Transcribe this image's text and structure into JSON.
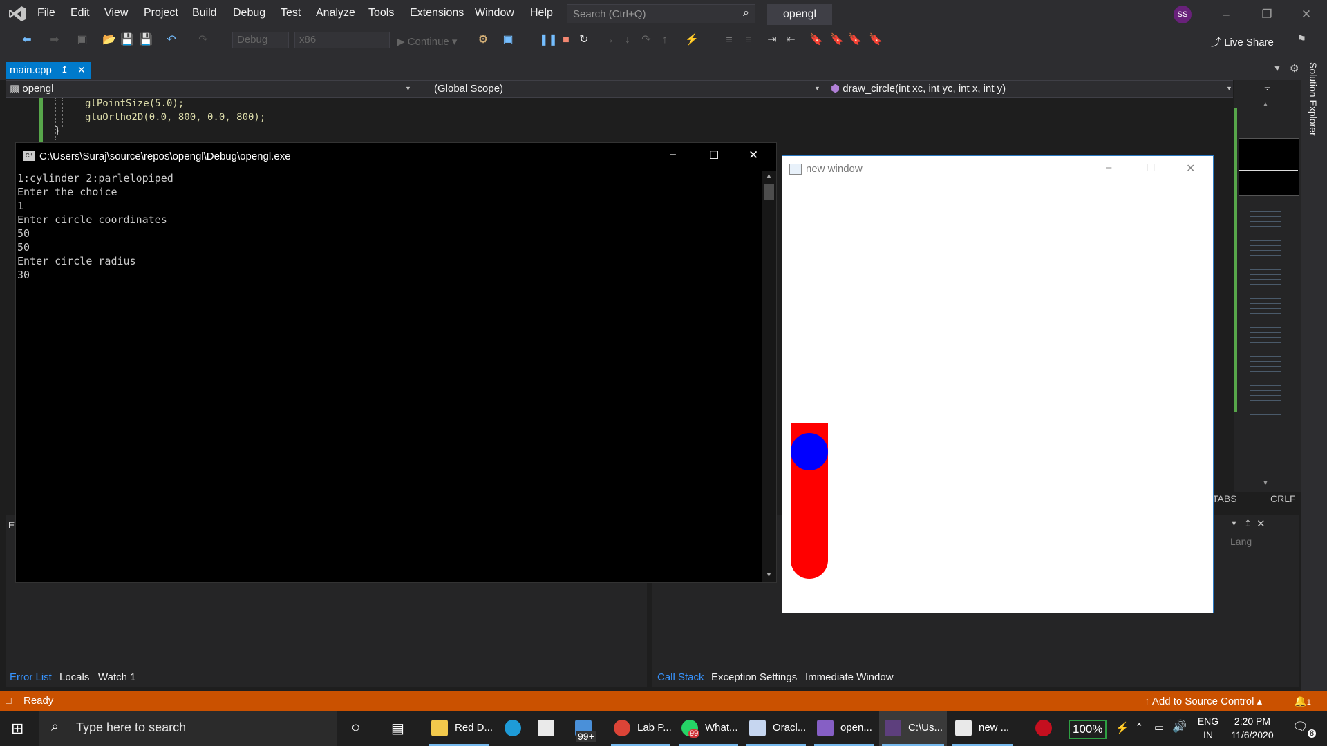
{
  "menubar": {
    "items": [
      "File",
      "Edit",
      "View",
      "Project",
      "Build",
      "Debug",
      "Test",
      "Analyze",
      "Tools",
      "Extensions",
      "Window",
      "Help"
    ],
    "search_placeholder": "Search (Ctrl+Q)",
    "project_name": "opengl",
    "avatar_initials": "SS"
  },
  "toolbar": {
    "config": "Debug",
    "platform": "x86",
    "continue_label": "Continue",
    "live_share": "Live Share"
  },
  "tabs": {
    "doc_tab": "main.cpp",
    "project_combo": "opengl",
    "scope_combo": "(Global Scope)",
    "function_combo": "draw_circle(int xc, int yc, int x, int y)"
  },
  "editor": {
    "code_lines": [
      "glPointSize(5.0);",
      "gluOrtho2D(0.0, 800, 0.0, 800);",
      "}"
    ]
  },
  "side": {
    "solution_explorer": "Solution Explorer"
  },
  "console": {
    "title": "C:\\Users\\Suraj\\source\\repos\\opengl\\Debug\\opengl.exe",
    "lines": [
      "1:cylinder 2:parlelopiped",
      "Enter the choice",
      "1",
      "Enter circle coordinates",
      "50",
      "50",
      "Enter circle radius",
      "30"
    ]
  },
  "glwindow": {
    "title": "new window",
    "colors": {
      "body": "#ff0000",
      "top": "#0000ff"
    }
  },
  "editor_status": {
    "tabs": "TABS",
    "crlf": "CRLF",
    "lang": "Lang"
  },
  "bottom": {
    "left_tabs": [
      "Error List",
      "Locals",
      "Watch 1"
    ],
    "right_tabs": [
      "Call Stack",
      "Exception Settings",
      "Immediate Window"
    ]
  },
  "status": {
    "ready": "Ready",
    "source_control": "Add to Source Control",
    "notifications": "1"
  },
  "taskbar": {
    "search_placeholder": "Type here to search",
    "apps": [
      {
        "label": "Red D...",
        "color": "#f2c94c"
      },
      {
        "label": "Lab P...",
        "color": "#db4437"
      },
      {
        "label": "What...",
        "color": "#25d366"
      },
      {
        "label": "Oracl...",
        "color": "#c6d6f0"
      },
      {
        "label": "open...",
        "color": "#865fc5"
      },
      {
        "label": "C:\\Us...",
        "color": "#5d3f7d"
      },
      {
        "label": "new ...",
        "color": "#e9e9e9"
      }
    ],
    "badge_mail": "99+",
    "badge_whatsapp": "99",
    "battery": "100%",
    "lang_top": "ENG",
    "lang_bottom": "IN",
    "time": "2:20 PM",
    "date": "11/6/2020",
    "notif_count": "8"
  }
}
